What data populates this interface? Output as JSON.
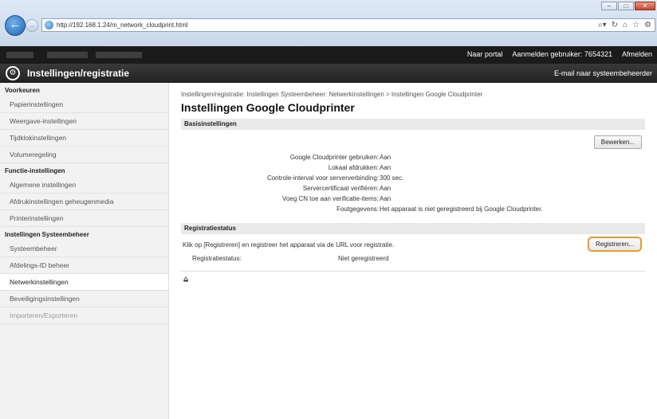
{
  "browser": {
    "url": "http://192.168.1.24/m_network_cloudprint.html",
    "window_controls": [
      "–",
      "□",
      "✕"
    ],
    "address_icons": [
      "⌕▾",
      "🔒",
      "↻",
      "⌂",
      "☆",
      "⚙"
    ]
  },
  "portal": {
    "links": [
      "Naar portal",
      "Aanmelden gebruiker:  7654321",
      "Afmelden"
    ]
  },
  "header": {
    "title": "Instellingen/registratie",
    "email_link": "E-mail naar systeembeheerder"
  },
  "sidebar": {
    "groups": [
      {
        "title": "Voorkeuren",
        "items": [
          "Papierinstellingen",
          "Weergave-instellingen",
          "Tijdklokinstellingen",
          "Volumeregeling"
        ]
      },
      {
        "title": "Functie-instellingen",
        "items": [
          "Algemene instellingen",
          "Afdrukinstellingen geheugenmedia",
          "Printerinstellingen"
        ]
      },
      {
        "title": "Instellingen Systeembeheer",
        "items": [
          "Systeembeheer",
          "Afdelings-ID beheer",
          "Netwerkinstellingen",
          "Beveiligingsinstellingen",
          "Importeren/Exporteren"
        ]
      }
    ],
    "active_item": "Netwerkinstellingen"
  },
  "main": {
    "breadcrumb": "Instellingen/registratie: Instellingen Systeembeheer: Netwerkinstellingen > Instellingen Google Cloudprinter",
    "page_title": "Instellingen Google Cloudprinter",
    "basic_section": "Basisinstellingen",
    "edit_button": "Bewerken...",
    "settings": [
      {
        "label": "Google Cloudprinter gebruiken:",
        "value": "Aan"
      },
      {
        "label": "Lokaal afdrukken:",
        "value": "Aan"
      },
      {
        "label": "Controle-interval voor serververbinding:",
        "value": "300 sec."
      },
      {
        "label": "Servercertificaat verifiëren:",
        "value": "Aan"
      },
      {
        "label": "Voeg CN toe aan verificatie-items:",
        "value": "Aan"
      },
      {
        "label": "Foutgegevens:",
        "value": "Het apparaat is niet geregistreerd bij Google Cloudprinter."
      }
    ],
    "reg_section": "Registratiestatus",
    "reg_instruction": "Klik op [Registreren] en registreer het apparaat via de URL voor registratie.",
    "reg_button": "Registreren...",
    "reg_status_label": "Registratiestatus:",
    "reg_status_value": "Niet geregistreerd",
    "top_icon": "⩠"
  }
}
